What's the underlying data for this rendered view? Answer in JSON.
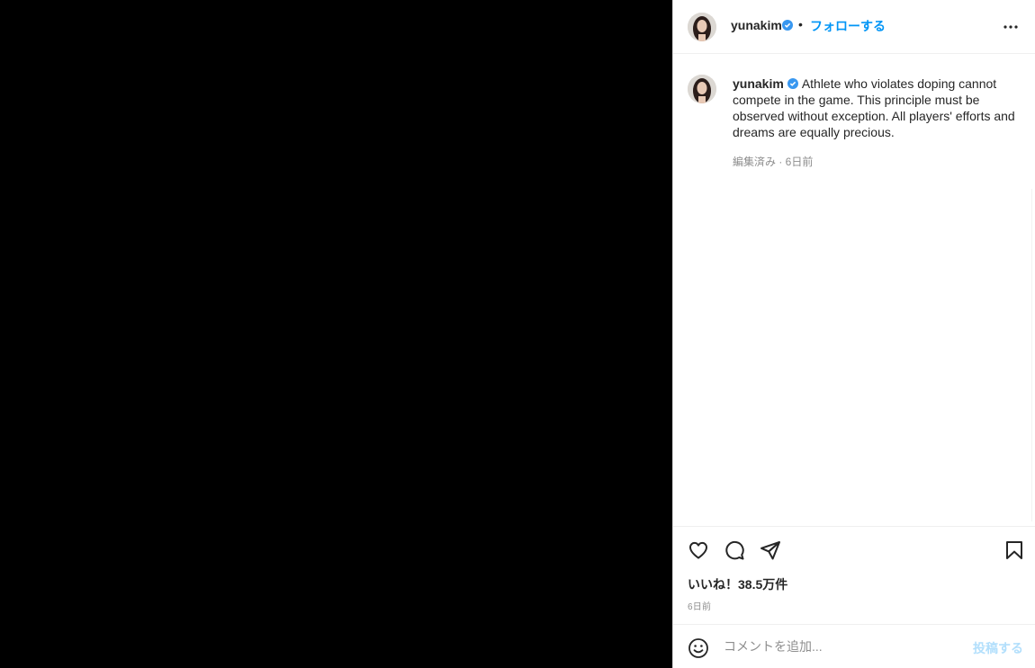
{
  "post": {
    "username": "yunakim",
    "dot": "•",
    "follow_label": "フォローする",
    "caption": "Athlete who violates doping cannot compete in the game. This principle must be observed without exception. All players' efforts and dreams are equally precious.",
    "meta": "編集済み · 6日前",
    "likes": "いいね！38.5万件",
    "time_ago": "6日前"
  },
  "comment_bar": {
    "placeholder": "コメントを追加...",
    "post_label": "投稿する"
  },
  "colors": {
    "accent": "#0095f6",
    "verified": "#3897f0",
    "post_disabled": "#b2dffc"
  },
  "icons": [
    "more-icon",
    "verified-icon",
    "heart-icon",
    "comment-icon",
    "share-icon",
    "save-icon",
    "emoji-icon"
  ]
}
